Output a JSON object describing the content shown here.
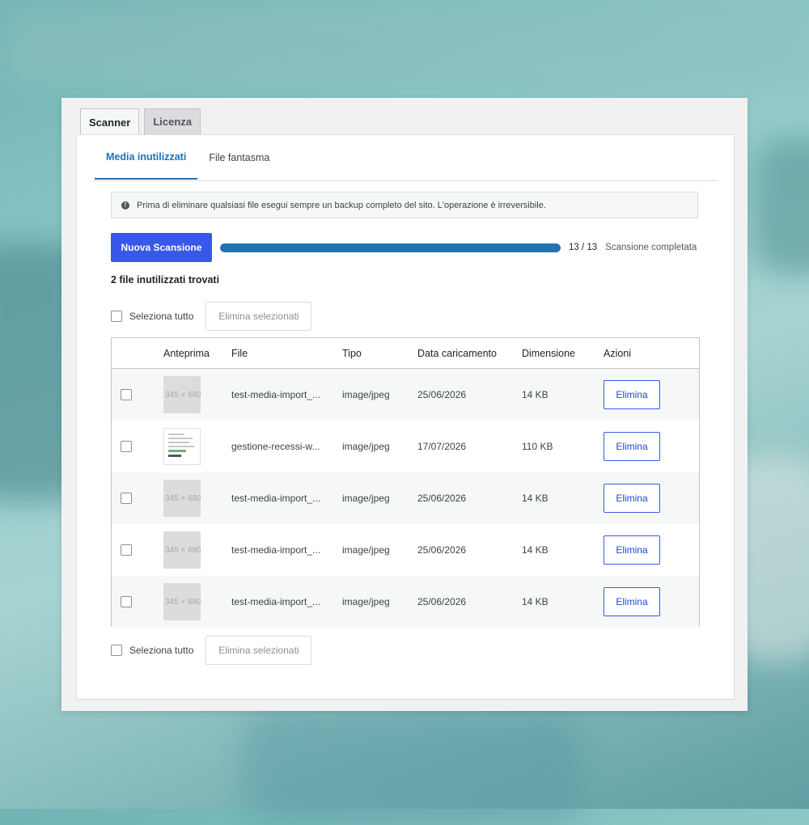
{
  "tabs": [
    {
      "label": "Scanner",
      "active": true
    },
    {
      "label": "Licenza",
      "active": false
    }
  ],
  "subtabs": [
    {
      "label": "Media inutilizzati",
      "active": true
    },
    {
      "label": "File fantasma",
      "active": false
    }
  ],
  "notice": {
    "icon": "exclamation-circle-icon",
    "text": "Prima di eliminare qualsiasi file esegui sempre un backup completo del sito. L'operazione è irreversibile."
  },
  "scan": {
    "button_label": "Nuova Scansione",
    "progress_fraction": 1.0,
    "count": "13 / 13",
    "status": "Scansione completata"
  },
  "results_title": "2 file inutilizzati trovati",
  "bulk": {
    "select_all_label": "Seleziona tutto",
    "delete_selected_label": "Elimina selezionati"
  },
  "table": {
    "headers": {
      "preview": "Anteprima",
      "file": "File",
      "type": "Tipo",
      "date": "Data caricamento",
      "size": "Dimensione",
      "actions": "Azioni"
    },
    "rows": [
      {
        "thumb": "345 × 680",
        "file": "test-media-import_...",
        "type": "image/jpeg",
        "date": "25/06/2026",
        "size": "14 KB",
        "action": "Elimina"
      },
      {
        "thumb": "",
        "file": "gestione-recessi-w...",
        "type": "image/jpeg",
        "date": "17/07/2026",
        "size": "110 KB",
        "action": "Elimina"
      },
      {
        "thumb": "345 × 680",
        "file": "test-media-import_...",
        "type": "image/jpeg",
        "date": "25/06/2026",
        "size": "14 KB",
        "action": "Elimina"
      },
      {
        "thumb": "345 × 680",
        "file": "test-media-import_...",
        "type": "image/jpeg",
        "date": "25/06/2026",
        "size": "14 KB",
        "action": "Elimina"
      },
      {
        "thumb": "345 × 680",
        "file": "test-media-import_...",
        "type": "image/jpeg",
        "date": "25/06/2026",
        "size": "14 KB",
        "action": "Elimina"
      }
    ]
  },
  "colors": {
    "primary": "#3858e9",
    "accent": "#2271b1",
    "progress_track": "#e0e0e0"
  }
}
